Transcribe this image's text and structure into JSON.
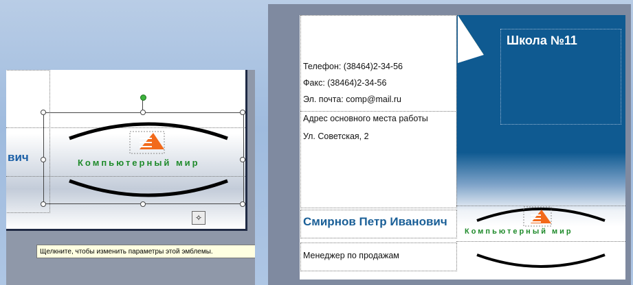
{
  "left_panel": {
    "name_fragment": "вич",
    "logo_text": "Компьютерный мир",
    "tooltip": "Щелкните, чтобы изменить параметры этой эмблемы.",
    "wand_icon": "magic-wand-icon"
  },
  "business_card": {
    "school": "Школа №11",
    "phone": "Телефон: (38464)2-34-56",
    "fax": "Факс: (38464)2-34-56",
    "email": "Эл. почта: comp@mail.ru",
    "address_label": "Адрес основного места работы",
    "address": "Ул. Советская, 2",
    "person_name": "Смирнов Петр Иванович",
    "position": "Менеджер по продажам",
    "logo_text": "Компьютерный мир"
  },
  "colors": {
    "accent_blue": "#0f5a91",
    "logo_green": "#1e8a2a",
    "logo_orange": "#f26a1b",
    "fold_yellow": "#f5c400"
  }
}
